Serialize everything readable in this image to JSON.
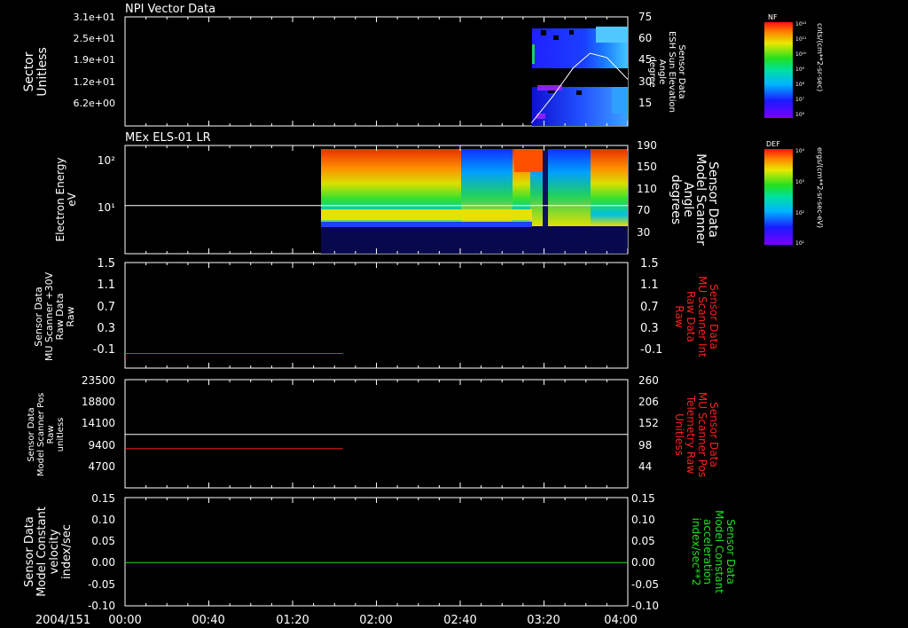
{
  "date_label": "2004/151",
  "time_ticks": [
    "00:00",
    "00:40",
    "01:20",
    "02:00",
    "02:40",
    "03:20",
    "04:00"
  ],
  "chart_data": [
    {
      "type": "heatmap",
      "title": "NPI Vector Data",
      "ylabel_lines": [
        "Sector",
        "Unitless"
      ],
      "yticks_left": [
        "3.1e+01",
        "2.5e+01",
        "1.9e+01",
        "1.2e+01",
        "6.2e+00"
      ],
      "ylabel_right_lines": [
        "Sensor Data",
        "ESH Sun Elevation",
        "Angle",
        "degree"
      ],
      "yticks_right": [
        "75",
        "60",
        "45",
        "30",
        "15"
      ],
      "overlay_line": {
        "name": "ESH Sun Elevation Angle",
        "color": "#ffffff",
        "x": [
          "03:14",
          "03:24",
          "03:34",
          "03:42",
          "03:50",
          "04:00"
        ],
        "y": [
          2,
          20,
          40,
          50,
          47,
          32
        ]
      },
      "colorbar": {
        "label": "NF",
        "unit": "cnts/(cm**2-sr-sec)",
        "ticks": [
          "10¹²",
          "10¹¹",
          "10¹⁰",
          "10⁹",
          "10⁸",
          "10⁷",
          "10⁶"
        ]
      },
      "data_extent_x": [
        "03:14",
        "04:00"
      ]
    },
    {
      "type": "heatmap",
      "title": "MEx ELS-01 LR",
      "ylabel_lines": [
        "Electron Energy",
        "eV"
      ],
      "yticks_left": [
        "10²",
        "10¹"
      ],
      "ylabel_right_lines": [
        "Sensor Data",
        "Model Scanner",
        "Angle",
        "degrees"
      ],
      "yticks_right": [
        "190",
        "150",
        "110",
        "70",
        "30"
      ],
      "overlay_line": {
        "name": "Model Scanner Angle",
        "color": "#ffffff",
        "x": [
          "00:00",
          "04:00"
        ],
        "y": [
          90,
          90
        ]
      },
      "colorbar": {
        "label": "DEF",
        "unit": "ergs/(cm**2-sr-sec-eV)",
        "ticks": [
          "10⁴",
          "10³",
          "10²",
          "10¹"
        ]
      },
      "data_extent_x": [
        "01:24",
        "04:00"
      ]
    },
    {
      "type": "line",
      "ylabel_lines": [
        "Sensor Data",
        "MU Scanner +30V",
        "Raw Data",
        "Raw"
      ],
      "yticks_left": [
        "1.5",
        "1.1",
        "0.7",
        "0.3",
        "-0.1"
      ],
      "ylabel_right_lines": [
        "Sensor Data",
        "MU Scanner Int",
        "Raw Data",
        "Raw"
      ],
      "ylabel_right_color": "#ff2020",
      "yticks_right": [
        "1.5",
        "1.1",
        "0.7",
        "0.3",
        "-0.1"
      ],
      "ylim": [
        -0.3,
        1.5
      ],
      "series": [
        {
          "color": "#ff2020",
          "x": [
            "00:00",
            "01:44"
          ],
          "y": [
            -0.05,
            -0.05
          ]
        }
      ]
    },
    {
      "type": "line",
      "ylabel_lines": [
        "Sensor Data",
        "Model Scanner Pos",
        "Raw",
        "unitless"
      ],
      "yticks_left": [
        "23500",
        "18800",
        "14100",
        "9400",
        "4700"
      ],
      "ylabel_right_lines": [
        "Sensor Data",
        "MU Scanner Pos",
        "Telemetry Raw",
        "Unitless"
      ],
      "ylabel_right_color": "#ff2020",
      "yticks_right": [
        "260",
        "206",
        "152",
        "98",
        "44"
      ],
      "ylim": [
        0,
        23500
      ],
      "series": [
        {
          "color": "#ffffff",
          "x": [
            "00:00",
            "04:00"
          ],
          "y": [
            11600,
            11600
          ]
        },
        {
          "color": "#ff2020",
          "x": [
            "00:00",
            "01:44"
          ],
          "y": [
            8500,
            8500
          ]
        }
      ]
    },
    {
      "type": "line",
      "ylabel_lines": [
        "Sensor Data",
        "Model Constant",
        "velocity",
        "index/sec"
      ],
      "yticks_left": [
        "0.15",
        "0.10",
        "0.05",
        "0.00",
        "-0.05",
        "-0.10"
      ],
      "ylabel_right_lines": [
        "Sensor Data",
        "Model Constant",
        "acceleration",
        "index/sec**2"
      ],
      "ylabel_right_color": "#20e020",
      "yticks_right": [
        "0.15",
        "0.10",
        "0.05",
        "0.00",
        "-0.05",
        "-0.10"
      ],
      "ylim": [
        -0.1,
        0.15
      ],
      "series": [
        {
          "color": "#20e020",
          "x": [
            "00:00",
            "04:00"
          ],
          "y": [
            0.0,
            0.0
          ]
        }
      ]
    }
  ]
}
